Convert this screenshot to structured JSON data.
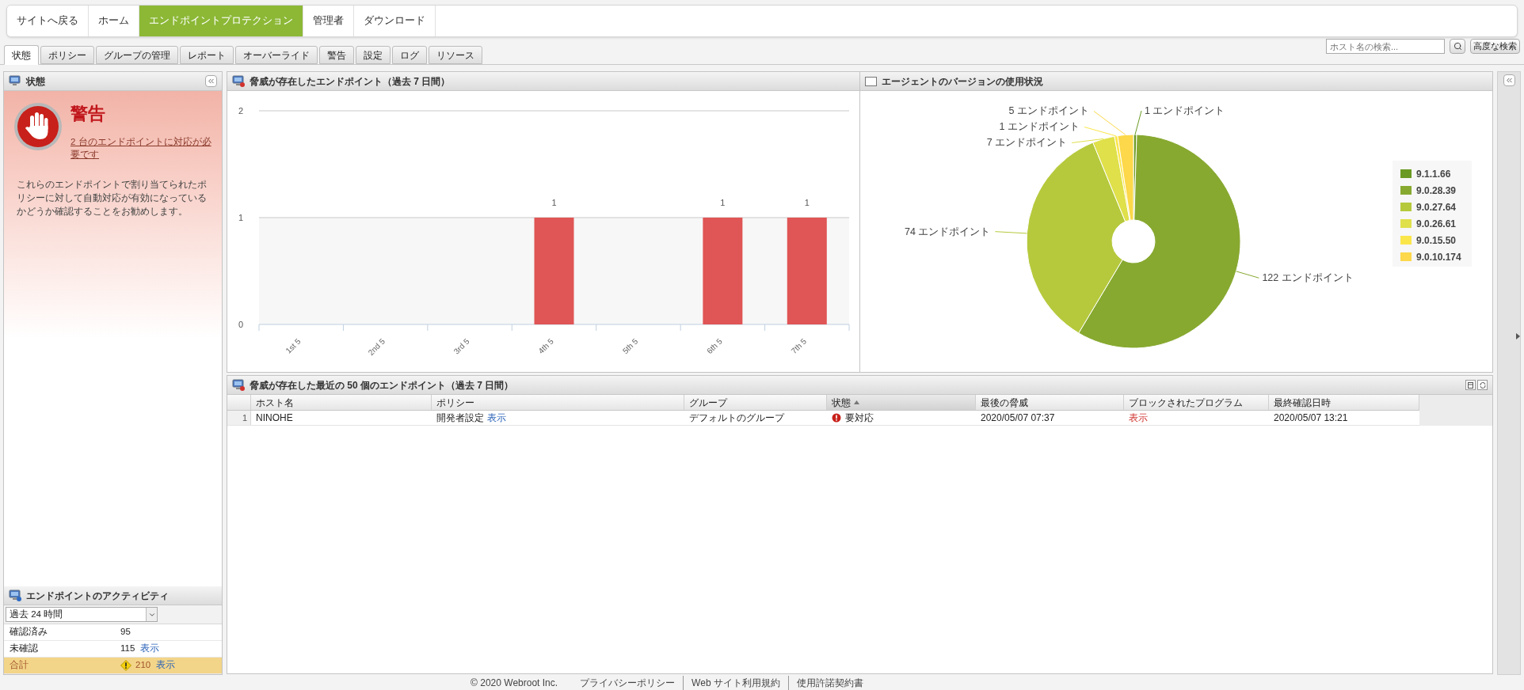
{
  "top_nav": [
    {
      "label": "サイトへ戻る",
      "selected": false
    },
    {
      "label": "ホーム",
      "selected": false
    },
    {
      "label": "エンドポイントプロテクション",
      "selected": true
    },
    {
      "label": "管理者",
      "selected": false
    },
    {
      "label": "ダウンロード",
      "selected": false
    }
  ],
  "tabs": [
    {
      "label": "状態",
      "selected": true
    },
    {
      "label": "ポリシー",
      "selected": false
    },
    {
      "label": "グループの管理",
      "selected": false
    },
    {
      "label": "レポート",
      "selected": false
    },
    {
      "label": "オーバーライド",
      "selected": false
    },
    {
      "label": "警告",
      "selected": false
    },
    {
      "label": "設定",
      "selected": false
    },
    {
      "label": "ログ",
      "selected": false
    },
    {
      "label": "リソース",
      "selected": false
    }
  ],
  "search": {
    "placeholder": "ホスト名の検索..."
  },
  "advanced_search_button": "高度な検索",
  "status_panel": {
    "title": "状態",
    "alert_title": "警告",
    "alert_link": "2 台のエンドポイントに対応が必要です",
    "message": "これらのエンドポイントで割り当てられたポリシーに対して自動対応が有効になっているかどうか確認することをお勧めします。"
  },
  "activity_panel": {
    "title": "エンドポイントのアクティビティ",
    "period": "過去 24 時間",
    "rows": [
      {
        "kind": "normal",
        "label": "確認済み",
        "count": "95"
      },
      {
        "kind": "normal",
        "label": "未確認",
        "count": "115",
        "link": "表示"
      },
      {
        "kind": "total",
        "label": "合計",
        "count": "210",
        "link": "表示"
      }
    ]
  },
  "threat_chart_panel": {
    "title": "脅威が存在したエンドポイント（過去 7 日間）",
    "chart_data": {
      "type": "bar",
      "categories": [
        "1st 5",
        "2nd 5",
        "3rd 5",
        "4th 5",
        "5th 5",
        "6th 5",
        "7th 5"
      ],
      "values": [
        0,
        0,
        0,
        1,
        0,
        1,
        1
      ],
      "ylim": [
        0,
        2
      ],
      "yticks": [
        0,
        1,
        2
      ],
      "value_labels": [
        null,
        null,
        null,
        "1",
        null,
        "1",
        "1"
      ]
    }
  },
  "version_panel": {
    "title": "エージェントのバージョンの使用状況",
    "chart_data": {
      "type": "donut",
      "categories": [
        "9.1.1.66",
        "9.0.28.39",
        "9.0.27.64",
        "9.0.26.61",
        "9.0.15.50",
        "9.0.10.174"
      ],
      "values": [
        1,
        122,
        74,
        7,
        1,
        5
      ],
      "value_labels": [
        "1 エンドポイント",
        "122 エンドポイント",
        "74 エンドポイント",
        "7 エンドポイント",
        "1 エンドポイント",
        "5 エンドポイント"
      ],
      "colors": [
        "#6a9a23",
        "#87a930",
        "#b6c93c",
        "#dfe04a",
        "#fbe64a",
        "#fcd84a"
      ],
      "legend": "right"
    }
  },
  "recent_panel": {
    "title": "脅威が存在した最近の 50 個のエンドポイント（過去 7 日間）",
    "columns": [
      {
        "label": "ホスト名",
        "sorted": false
      },
      {
        "label": "ポリシー",
        "sorted": false
      },
      {
        "label": "グループ",
        "sorted": false
      },
      {
        "label": "状態",
        "sorted": true
      },
      {
        "label": "最後の脅威",
        "sorted": false
      },
      {
        "label": "ブロックされたプログラム",
        "sorted": false
      },
      {
        "label": "最終確認日時",
        "sorted": false
      }
    ],
    "rows": [
      {
        "index": "1",
        "host": "NINOHE",
        "policy": "開発者設定",
        "policy_link": "表示",
        "group": "デフォルトのグループ",
        "status": "要対応",
        "last_threat": "2020/05/07 07:37",
        "blocked_link": "表示",
        "last_seen": "2020/05/07 13:21"
      }
    ]
  },
  "footer": {
    "copyright": "© 2020 Webroot Inc.",
    "links": [
      "プライバシーポリシー",
      "Web サイト利用規約",
      "使用許諾契約書"
    ]
  }
}
